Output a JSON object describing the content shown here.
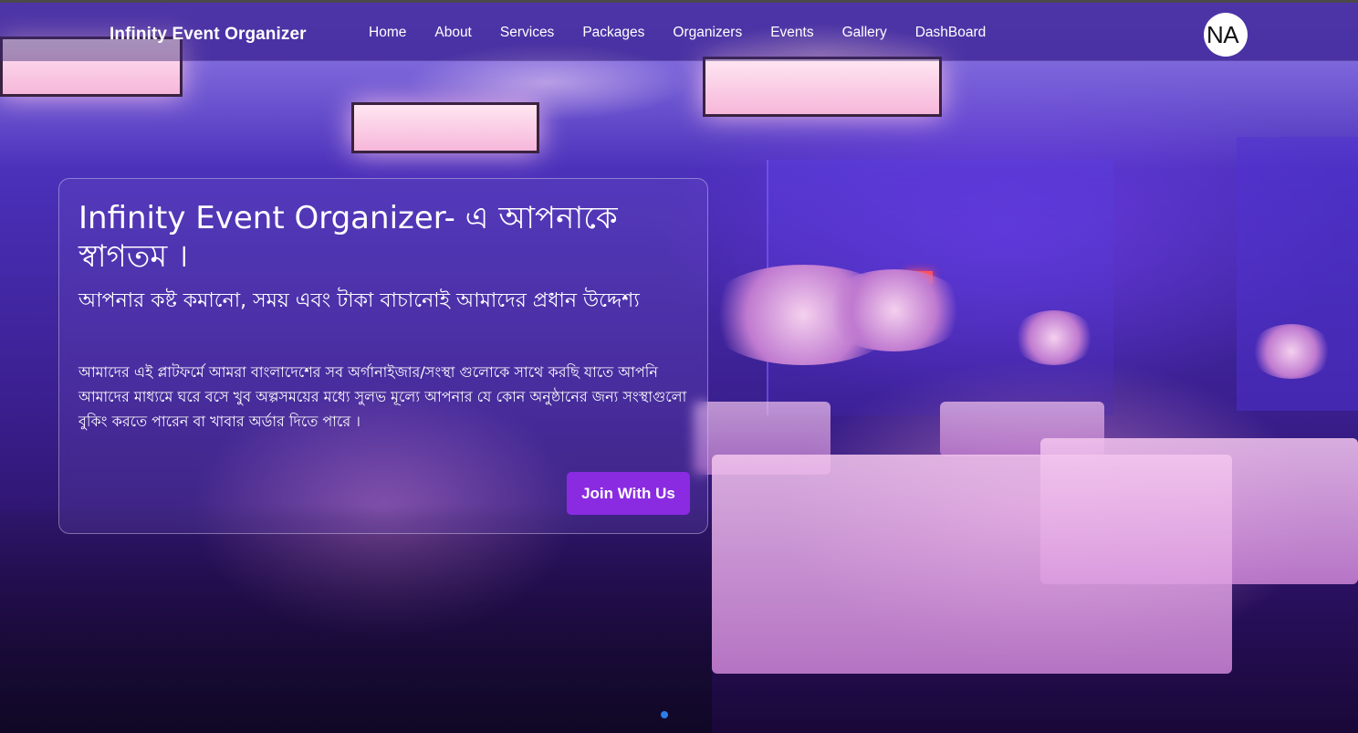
{
  "navbar": {
    "brand": "Infinity Event Organizer",
    "links": [
      "Home",
      "About",
      "Services",
      "Packages",
      "Organizers",
      "Events",
      "Gallery",
      "DashBoard"
    ],
    "avatar_text": "NA"
  },
  "hero": {
    "title": "Infinity Event Organizer- এ আপনাকে স্বাগতম ।",
    "subtitle": "আপনার কষ্ট কমানো, সময় এবং টাকা বাচানোই আমাদের প্রধান উদ্দেশ্য",
    "description": "আমাদের এই প্লাটফর্মে আমরা বাংলাদেশের সব অর্গানাইজার/সংস্থা গুলোকে সাথে করছি যাতে আপনি আমাদের মাধ্যমে ঘরে বসে খুব অল্পসময়ের মধ্যে সুলভ মূল্যে আপনার যে কোন অনুষ্ঠানের জন্য সংস্থাগুলো বুকিং করতে পারেন বা খাবার অর্ডার দিতে পারে ।",
    "button_label": "Join With Us"
  },
  "colors": {
    "accent": "#8a2be2",
    "carousel_dot": "#2b7de9"
  }
}
